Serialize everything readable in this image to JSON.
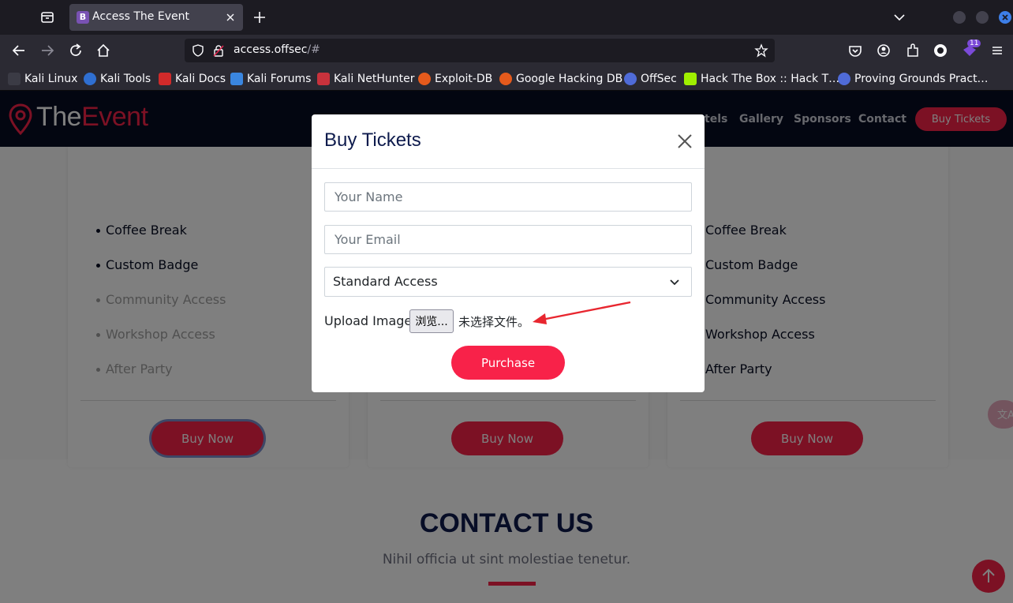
{
  "browser": {
    "tab_title": "Access The Event",
    "tab_favicon_letter": "B",
    "url_host": "access.offsec",
    "url_path": "/#",
    "extension_badge": "11",
    "bookmarks": [
      "Kali Linux",
      "Kali Tools",
      "Kali Docs",
      "Kali Forums",
      "Kali NetHunter",
      "Exploit-DB",
      "Google Hacking DB",
      "OffSec",
      "Hack The Box :: Hack T…",
      "Proving Grounds Pract…"
    ]
  },
  "site": {
    "logo_main": "The",
    "logo_accent": "Event",
    "nav": [
      "tels",
      "Gallery",
      "Sponsors",
      "Contact"
    ],
    "buy_tickets": "Buy Tickets",
    "card_features": [
      "Coffee Break",
      "Custom Badge",
      "Community Access",
      "Workshop Access",
      "After Party"
    ],
    "buy_now": "Buy Now",
    "contact_title": "CONTACT US",
    "contact_subtitle": "Nihil officia ut sint molestiae tenetur.",
    "translate_label": "文A"
  },
  "modal": {
    "title": "Buy Tickets",
    "name_placeholder": "Your Name",
    "email_placeholder": "Your Email",
    "select_value": "Standard Access",
    "upload_label": "Upload Image:",
    "browse_label": "浏览...",
    "no_file_text": "未选择文件。",
    "purchase_label": "Purchase"
  },
  "colors": {
    "accent": "#f82249",
    "header_bg": "#060c22",
    "title_navy": "#0e1b4d"
  }
}
